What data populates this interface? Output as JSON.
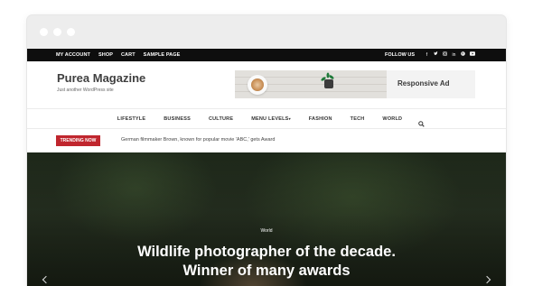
{
  "topbar": {
    "links": [
      "MY ACCOUNT",
      "SHOP",
      "CART",
      "SAMPLE PAGE"
    ],
    "follow_label": "FOLLOW US",
    "social_icons": [
      "facebook-icon",
      "twitter-icon",
      "instagram-icon",
      "linkedin-icon",
      "pinterest-icon",
      "youtube-icon"
    ]
  },
  "header": {
    "site_title": "Purea Magazine",
    "tagline": "Just another WordPress site",
    "ad_label": "Responsive Ad"
  },
  "main_nav": {
    "items": [
      "LIFESTYLE",
      "BUSINESS",
      "CULTURE",
      "MENU LEVELS",
      "FASHION",
      "TECH",
      "WORLD"
    ],
    "dropdown_marker": "▾"
  },
  "trending": {
    "badge": "TRENDING NOW",
    "headline": "German filmmaker Brown, known for popular movie 'ABC,' gets Award"
  },
  "hero": {
    "category": "World",
    "title_line1": "Wildlife photographer of the decade.",
    "title_line2": "Winner of many awards"
  },
  "colors": {
    "topbar_bg": "#0e0e0e",
    "accent_red": "#c0262e",
    "title_gray": "#3f3f3f"
  }
}
